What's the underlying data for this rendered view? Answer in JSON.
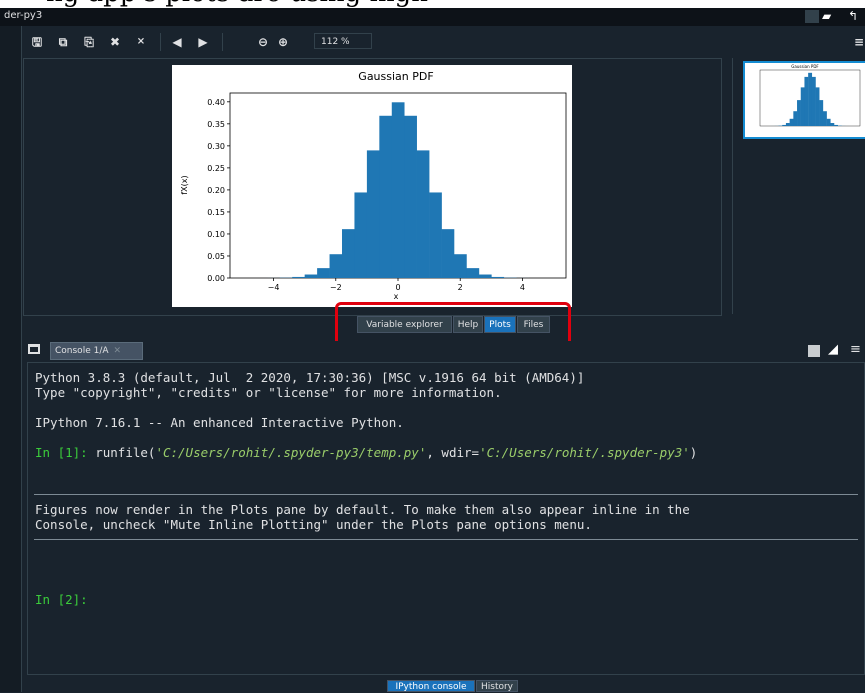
{
  "caption": "ng app's plots are using high-",
  "window": {
    "title": "der-py3"
  },
  "toolbar": {
    "icons": [
      "save-icon",
      "save-all-icon",
      "copy-icon",
      "close-icon",
      "close-all-icon",
      "back-arrow-icon",
      "forward-arrow-icon",
      "zoom-out-icon",
      "zoom-in-icon"
    ],
    "zoom_value": "112 %"
  },
  "plot": {
    "title": "Gaussian PDF",
    "thumbnail_title": "Gaussian PDF"
  },
  "chart_data": {
    "type": "bar",
    "title": "Gaussian PDF",
    "xlabel": "x",
    "ylabel": "f_X(x)",
    "ylabel_display": "fX(x)",
    "xlim": [
      -5.4,
      5.4
    ],
    "ylim": [
      0,
      0.42
    ],
    "xticks": [
      "−4",
      "−2",
      "0",
      "2",
      "4"
    ],
    "yticks": [
      "0.00",
      "0.05",
      "0.10",
      "0.15",
      "0.20",
      "0.25",
      "0.30",
      "0.35",
      "0.40"
    ],
    "x": [
      -4.0,
      -3.6,
      -3.2,
      -2.8,
      -2.4,
      -2.0,
      -1.6,
      -1.2,
      -0.8,
      -0.4,
      0.0,
      0.4,
      0.8,
      1.2,
      1.6,
      2.0,
      2.4,
      2.8,
      3.2,
      3.6,
      4.0
    ],
    "values": [
      0.0001,
      0.0006,
      0.0024,
      0.0079,
      0.0224,
      0.054,
      0.1109,
      0.1942,
      0.2897,
      0.3683,
      0.3989,
      0.3683,
      0.2897,
      0.1942,
      0.1109,
      0.054,
      0.0224,
      0.0079,
      0.0024,
      0.0006,
      0.0001
    ],
    "color": "#1f77b4"
  },
  "pane_tabs": [
    {
      "label": "Variable explorer",
      "selected": false
    },
    {
      "label": "Help",
      "selected": false
    },
    {
      "label": "Plots",
      "selected": true
    },
    {
      "label": "Files",
      "selected": false
    }
  ],
  "console": {
    "tab_label": "Console 1/A",
    "lines": {
      "l1": "Python 3.8.3 (default, Jul  2 2020, 17:30:36) [MSC v.1916 64 bit (AMD64)]",
      "l2": "Type \"copyright\", \"credits\" or \"license\" for more information.",
      "l3": "IPython 7.16.1 -- An enhanced Interactive Python.",
      "in1_prompt": "In [1]: ",
      "in1_cmd_a": "runfile(",
      "in1_str1": "'C:/Users/rohit/.spyder-py3/temp.py'",
      "in1_cmd_b": ", wdir=",
      "in1_str2": "'C:/Users/rohit/.spyder-py3'",
      "in1_cmd_c": ")",
      "n1": "Figures now render in the Plots pane by default. To make them also appear inline in the",
      "n2": "Console, uncheck \"Mute Inline Plotting\" under the Plots pane options menu.",
      "in2_prompt": "In [2]:"
    }
  },
  "bottom_tabs": [
    {
      "label": "IPython console",
      "selected": true
    },
    {
      "label": "History",
      "selected": false
    }
  ],
  "colors": {
    "background": "#19232d",
    "accent": "#1a72bb",
    "highlight_box": "#e0000e",
    "prompt": "#3bcc3b"
  }
}
